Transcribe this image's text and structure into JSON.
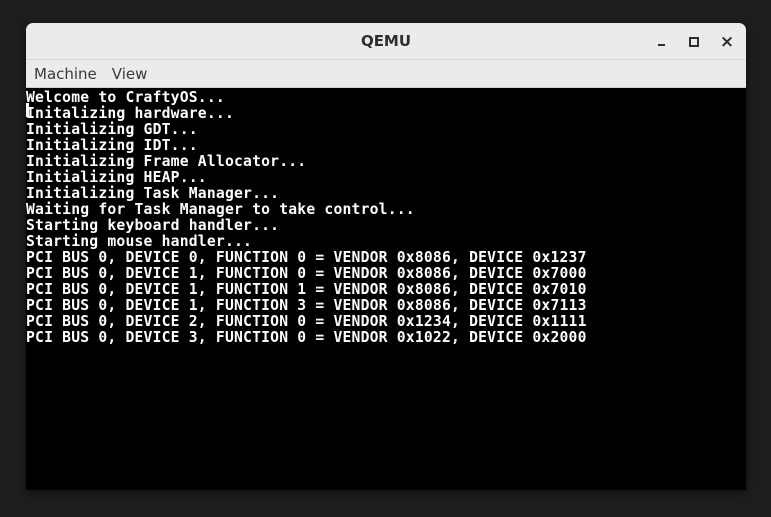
{
  "window": {
    "title": "QEMU",
    "minimize_icon": "minimize-icon",
    "maximize_icon": "maximize-icon",
    "close_icon": "close-icon",
    "close_glyph": "×"
  },
  "menubar": {
    "items": [
      {
        "label": "Machine"
      },
      {
        "label": "View"
      }
    ]
  },
  "console": {
    "lines": [
      "Welcome to CraftyOS...",
      "Initalizing hardware...",
      "Initializing GDT...",
      "Initializing IDT...",
      "Initializing Frame Allocator...",
      "Initializing HEAP...",
      "Initializing Task Manager...",
      "Waiting for Task Manager to take control...",
      "Starting keyboard handler...",
      "Starting mouse handler...",
      "PCI BUS 0, DEVICE 0, FUNCTION 0 = VENDOR 0x8086, DEVICE 0x1237",
      "PCI BUS 0, DEVICE 1, FUNCTION 0 = VENDOR 0x8086, DEVICE 0x7000",
      "PCI BUS 0, DEVICE 1, FUNCTION 1 = VENDOR 0x8086, DEVICE 0x7010",
      "PCI BUS 0, DEVICE 1, FUNCTION 3 = VENDOR 0x8086, DEVICE 0x7113",
      "PCI BUS 0, DEVICE 2, FUNCTION 0 = VENDOR 0x1234, DEVICE 0x1111",
      "PCI BUS 0, DEVICE 3, FUNCTION 0 = VENDOR 0x1022, DEVICE 0x2000"
    ]
  },
  "colors": {
    "background": "#1e1e1e",
    "titlebar": "#ebebeb",
    "screen": "#000000",
    "text": "#ffffff"
  }
}
